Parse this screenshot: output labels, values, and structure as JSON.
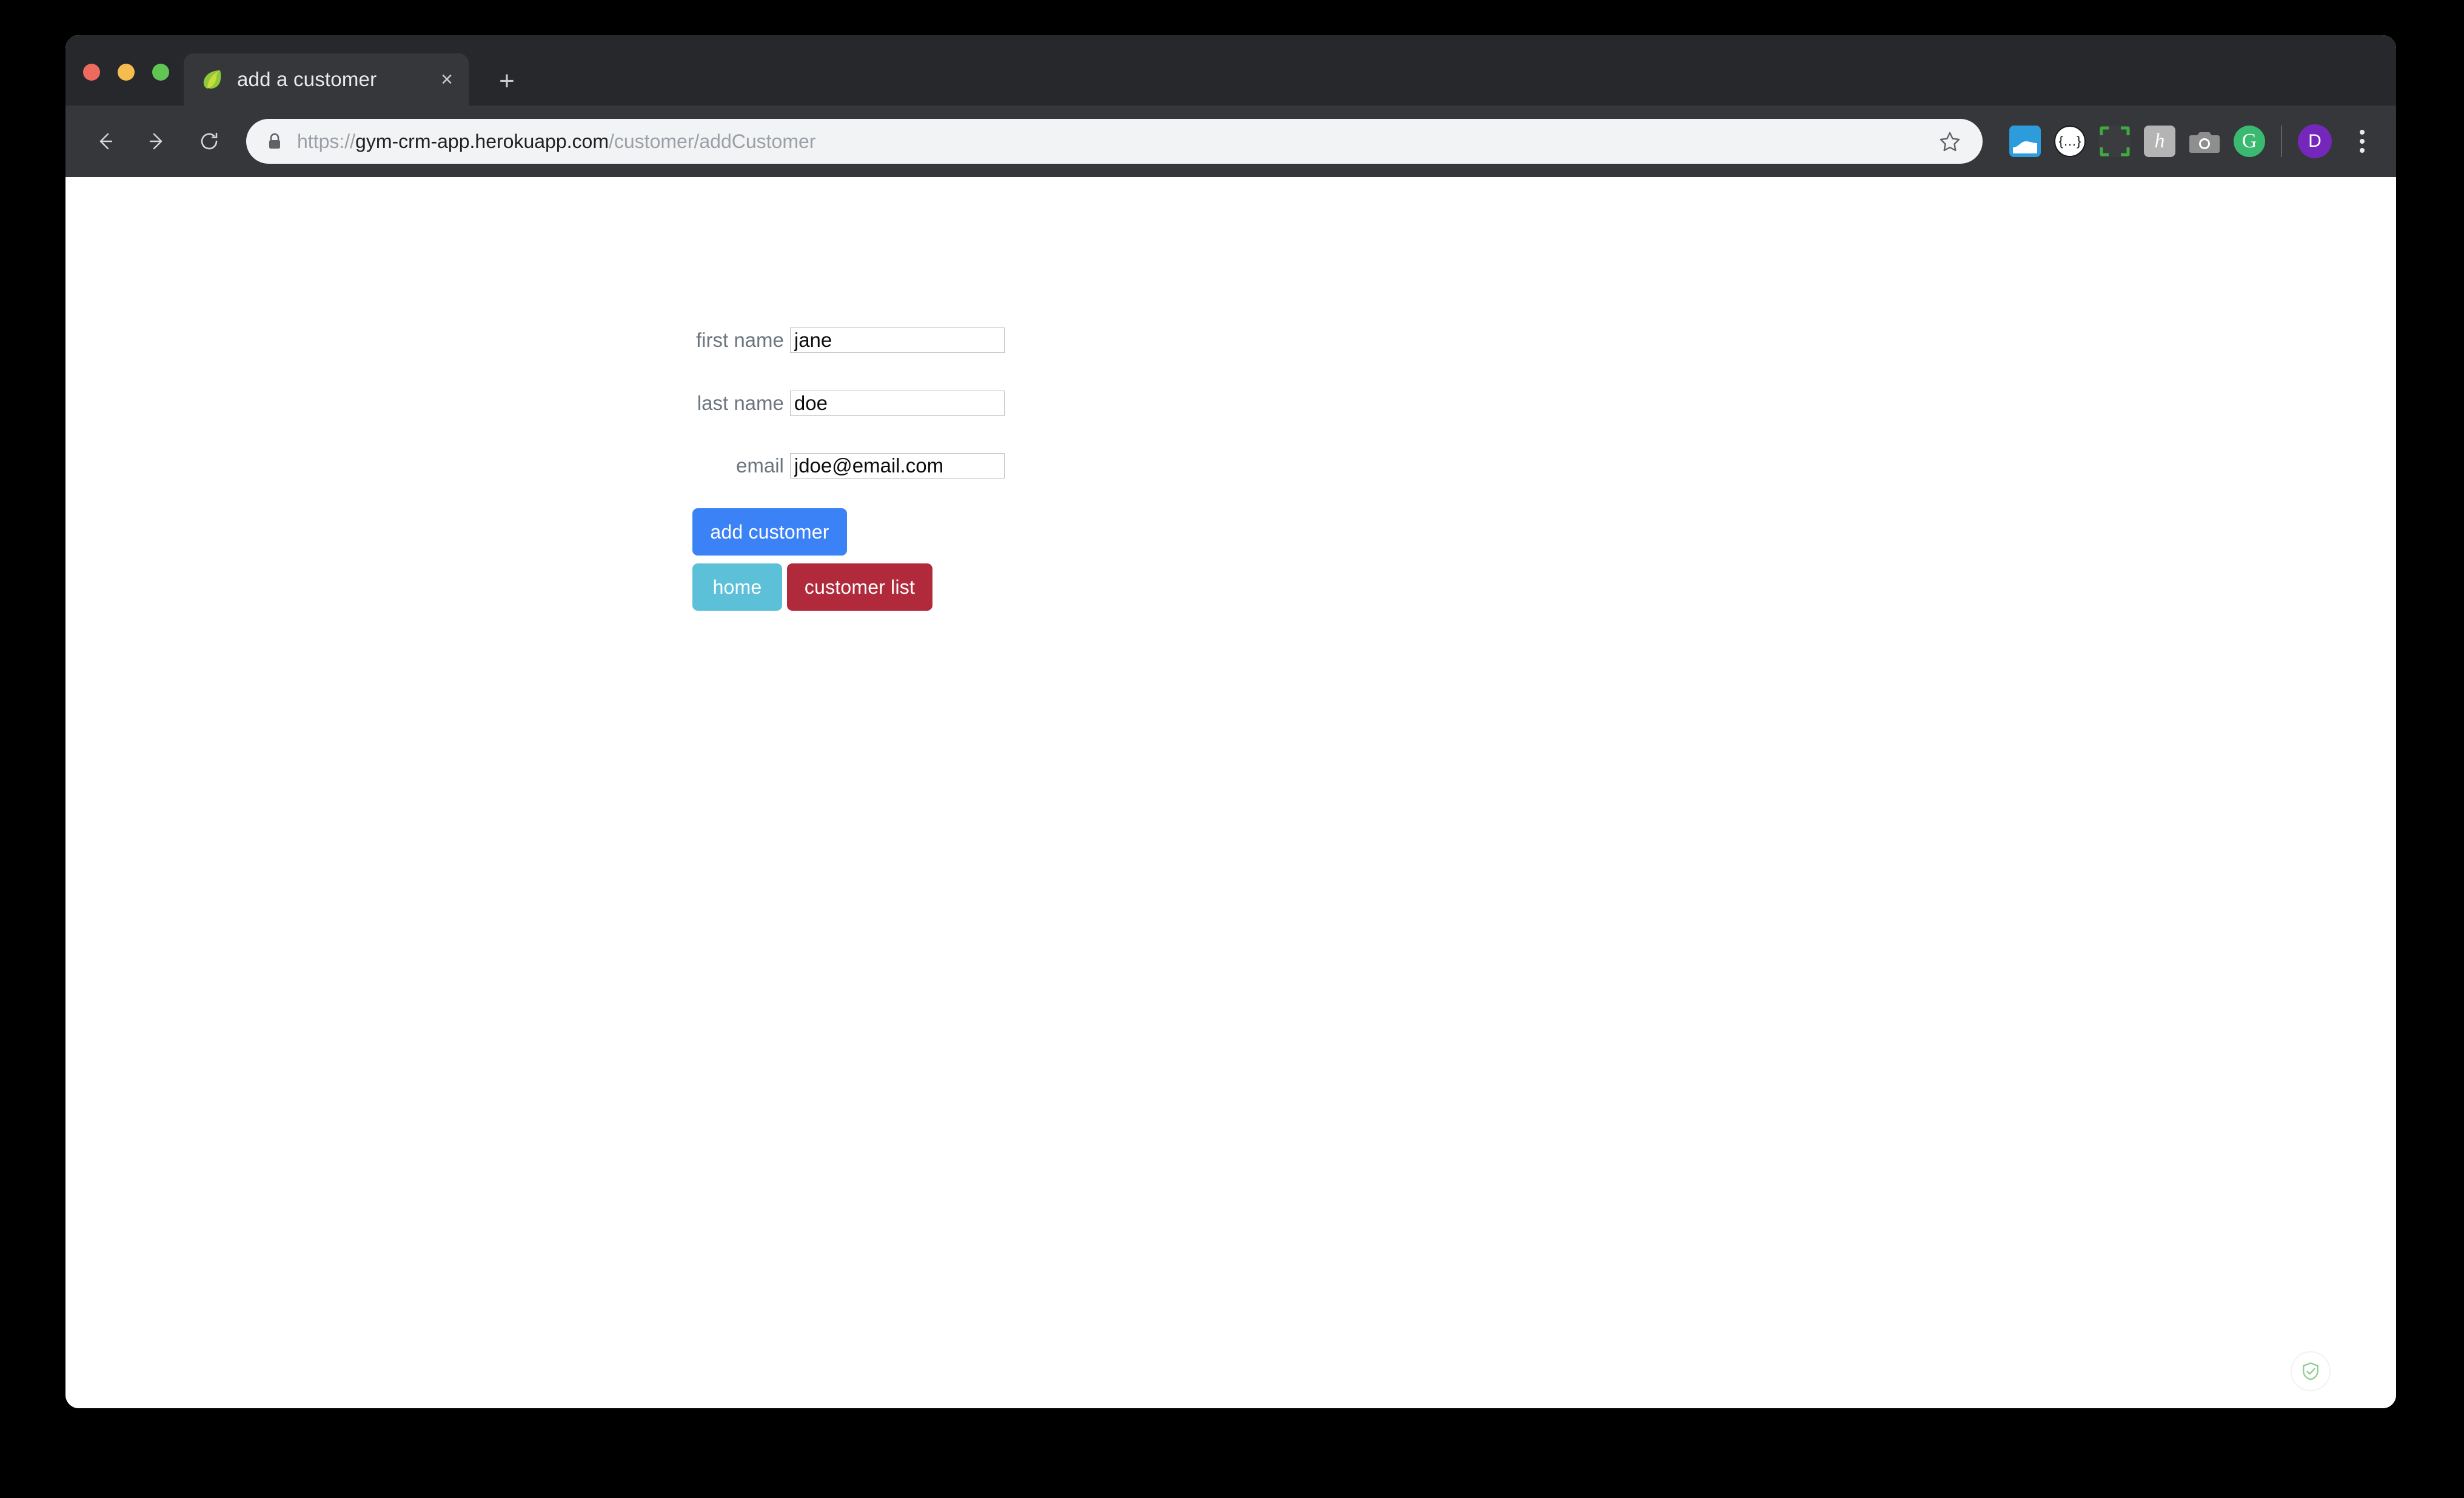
{
  "window": {
    "traffic_lights": [
      {
        "name": "close",
        "color": "#ed6a5e"
      },
      {
        "name": "minimize",
        "color": "#f5bd4f"
      },
      {
        "name": "zoom",
        "color": "#61c554"
      }
    ]
  },
  "tab_strip": {
    "active_tab": {
      "title": "add a customer",
      "favicon": "spring-leaf-icon",
      "close_label": "×"
    },
    "new_tab_label": "+"
  },
  "toolbar": {
    "back_icon": "arrow-left-icon",
    "forward_icon": "arrow-right-icon",
    "reload_icon": "reload-icon",
    "lock_icon": "lock-icon",
    "url": {
      "scheme": "https://",
      "host": "gym-crm-app.herokuapp.com",
      "path": "/customer/addCustomer",
      "full": "https://gym-crm-app.herokuapp.com/customer/addCustomer"
    },
    "bookmark_icon": "star-outline-icon",
    "extensions": [
      {
        "name": "extension-blue-window-icon",
        "label": "",
        "color": "#2d9cdb"
      },
      {
        "name": "extension-json-viewer-icon",
        "label": "{…}",
        "color": "#ffffff"
      },
      {
        "name": "extension-screen-capture-icon",
        "label": "",
        "color": "#3a3c40"
      },
      {
        "name": "extension-honey-icon",
        "label": "h",
        "color": "#b4b4b4"
      },
      {
        "name": "extension-camera-icon",
        "label": "",
        "color": "#8e8e8e"
      },
      {
        "name": "extension-grammarly-icon",
        "label": "G",
        "color": "#3ab971"
      }
    ],
    "profile": {
      "initial": "D",
      "color": "#7627bb"
    },
    "menu_icon": "three-dot-menu-icon"
  },
  "page": {
    "form": {
      "fields": [
        {
          "label": "first name",
          "value": "jane",
          "placeholder": "",
          "name": "first-name"
        },
        {
          "label": "last name",
          "value": "doe",
          "placeholder": "",
          "name": "last-name"
        },
        {
          "label": "email",
          "value": "jdoe@email.com",
          "placeholder": "",
          "name": "email"
        }
      ],
      "buttons": {
        "submit": {
          "label": "add customer",
          "color": "#3b82f6"
        },
        "home": {
          "label": "home",
          "color": "#5bc0d8"
        },
        "customer_list": {
          "label": "customer list",
          "color": "#b02a3c"
        }
      }
    },
    "badge_icon": "shield-check-icon"
  }
}
